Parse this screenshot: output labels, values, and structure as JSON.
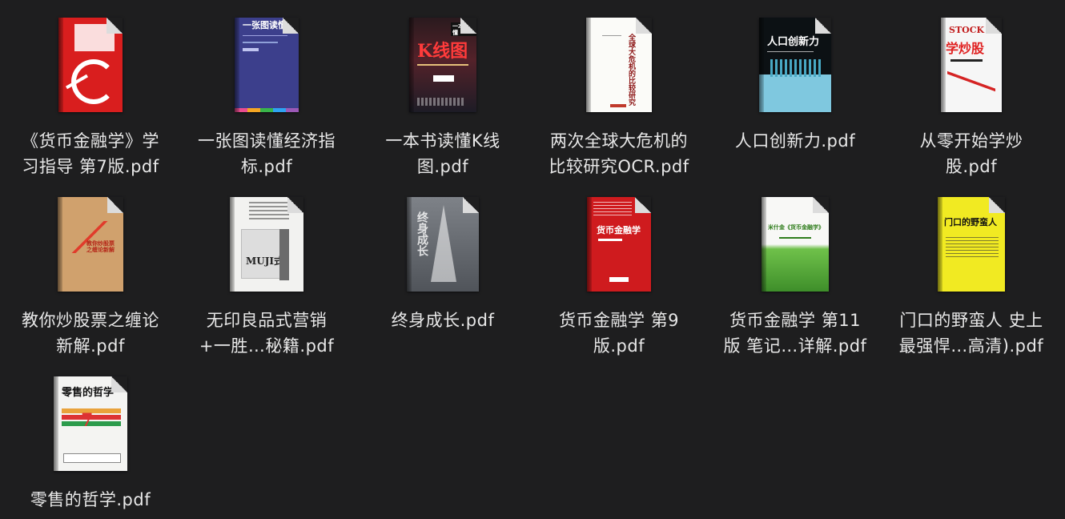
{
  "files": [
    {
      "line1": "《货币金融学》学",
      "line2": "习指导  第7版.pdf",
      "cover": "red-white"
    },
    {
      "line1": "一张图读懂经济指",
      "line2": "标.pdf",
      "cover": "navy",
      "cover_title": "一张图读懂经"
    },
    {
      "line1": "一本书读懂K线",
      "line2": "图.pdf",
      "cover": "dark-red",
      "cover_title": "K线图",
      "cover_badge": "一本书读懂"
    },
    {
      "line1": "两次全球大危机的",
      "line2": "比较研究OCR.pdf",
      "cover": "white",
      "cover_title": "全球大危机的比较研究"
    },
    {
      "line1": "人口创新力.pdf",
      "line2": "",
      "cover": "black-cyan",
      "cover_title": "人口创新力"
    },
    {
      "line1": "从零开始学炒",
      "line2": "股.pdf",
      "cover": "red-stock",
      "cover_title": "学炒股",
      "cover_badge": "STOCK"
    },
    {
      "line1": "教你炒股票之缠论",
      "line2": "新解.pdf",
      "cover": "tan",
      "cover_title": "教你炒股票之缠论新解"
    },
    {
      "line1": "无印良品式营销",
      "line2": "+一胜…秘籍.pdf",
      "cover": "white-muji",
      "cover_title": "MUJI式"
    },
    {
      "line1": "终身成长.pdf",
      "line2": "",
      "cover": "grey",
      "cover_title": "终身成长"
    },
    {
      "line1": "货币金融学 第9",
      "line2": "版.pdf",
      "cover": "red-book",
      "cover_title": "货币金融学"
    },
    {
      "line1": "货币金融学 第11",
      "line2": "版 笔记…详解.pdf",
      "cover": "green",
      "cover_title": "米什金《货币金融学》"
    },
    {
      "line1": "门口的野蛮人 史上",
      "line2": "最强悍…高清).pdf",
      "cover": "yellow",
      "cover_title": "门口的野蛮人"
    },
    {
      "line1": "零售的哲学.pdf",
      "line2": "",
      "cover": "seven",
      "cover_title": "零售的哲学"
    }
  ]
}
